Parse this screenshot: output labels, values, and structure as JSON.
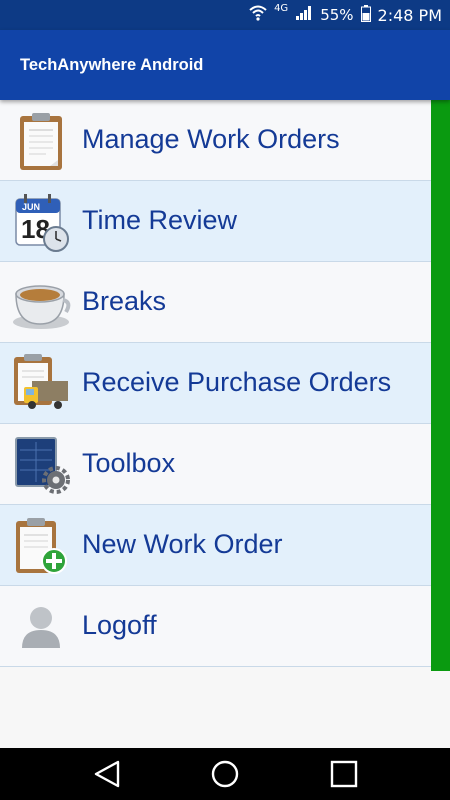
{
  "status_bar": {
    "network": "4G",
    "battery": "55%",
    "time": "2:48 PM"
  },
  "app_bar": {
    "title": "TechAnywhere Android"
  },
  "menu": [
    {
      "label": "Manage Work Orders",
      "icon": "clipboard-icon"
    },
    {
      "label": "Time Review",
      "icon": "calendar-clock-icon"
    },
    {
      "label": "Breaks",
      "icon": "coffee-cup-icon"
    },
    {
      "label": "Receive Purchase Orders",
      "icon": "clipboard-truck-icon"
    },
    {
      "label": "Toolbox",
      "icon": "toolbox-gear-icon"
    },
    {
      "label": "New Work Order",
      "icon": "clipboard-add-icon"
    },
    {
      "label": "Logoff",
      "icon": "user-icon"
    }
  ],
  "calendar_icon": {
    "month": "JUN",
    "day": "18"
  },
  "colors": {
    "status_bar": "#0d3a85",
    "app_bar": "#1144a8",
    "label_text": "#143a96",
    "row_alt": "#e3f0fb",
    "accent_green": "#0a9a10"
  }
}
